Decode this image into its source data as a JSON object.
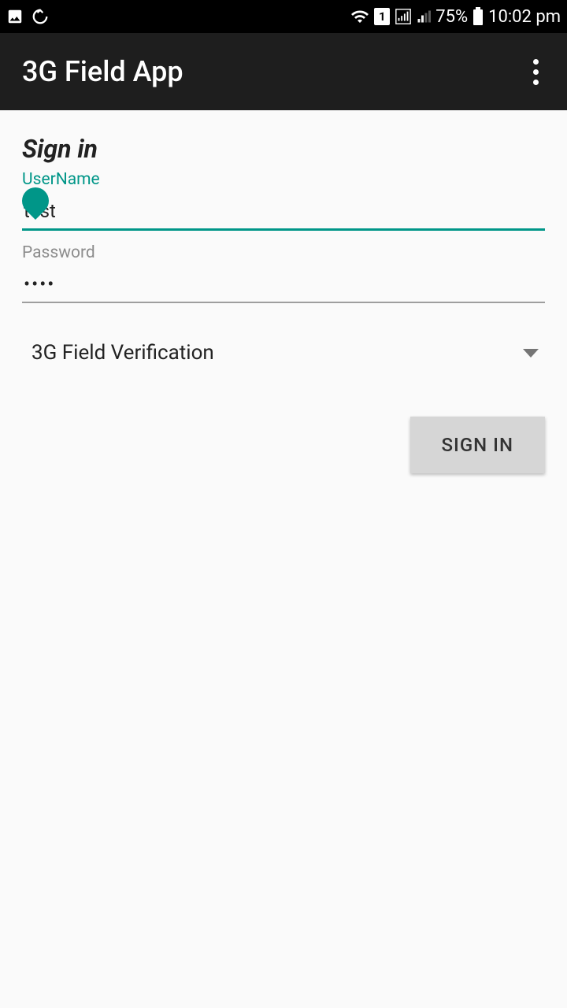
{
  "status_bar": {
    "battery_pct": "75%",
    "time": "10:02 pm",
    "sim_badge": "1"
  },
  "app_bar": {
    "title": "3G Field App"
  },
  "form": {
    "heading": "Sign in",
    "username_label": "UserName",
    "username_value": "test",
    "password_label": "Password",
    "password_value": "••••",
    "dropdown_selected": "3G Field Verification",
    "signin_button": "SIGN IN"
  },
  "colors": {
    "accent": "#009688",
    "app_bar_bg": "#1e1e1e"
  }
}
